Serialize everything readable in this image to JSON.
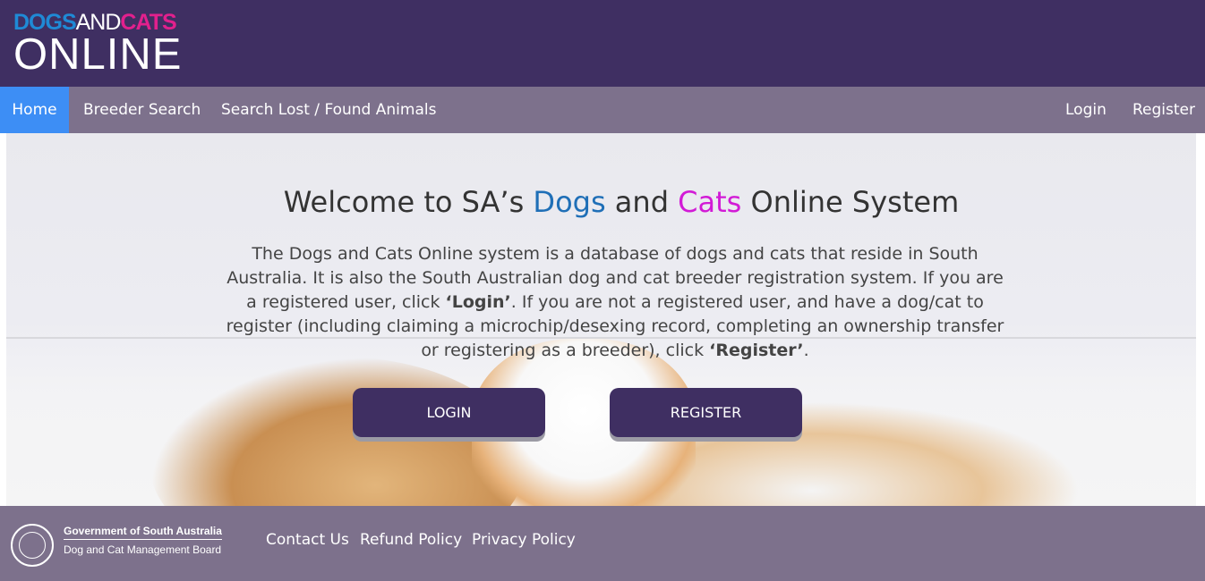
{
  "header": {
    "logo_word1": "DOGS",
    "logo_word2": "AND",
    "logo_word3": "CATS",
    "logo_bottom": "ONLINE",
    "logo_colors": {
      "dogs": "#1f8ad6",
      "and": "#ffffff",
      "cats": "#e2208d"
    }
  },
  "nav": {
    "home": "Home",
    "breeder_search": "Breeder Search",
    "lost_found": "Search Lost / Found Animals",
    "login": "Login",
    "register": "Register"
  },
  "hero": {
    "title_part1": "Welcome to SA’s ",
    "title_dogs": "Dogs",
    "title_and": " and ",
    "title_cats": "Cats",
    "title_part2": " Online System",
    "desc_1": "The Dogs and Cats Online system is a database of dogs and cats that reside in South Australia. It is also the South Australian dog and cat breeder registration system. If you are a registered user, click ",
    "desc_login": "‘Login’",
    "desc_2": ". If you are not a registered user, and have a dog/cat to register (including claiming a microchip/desexing record, completing an ownership transfer or registering as a breeder), click ",
    "desc_register": "‘Register’",
    "desc_3": ".",
    "login_button": "LOGIN",
    "register_button": "REGISTER"
  },
  "footer": {
    "gov_line1": "Government of South Australia",
    "gov_line2": "Dog and Cat Management Board",
    "contact": "Contact Us",
    "refund": "Refund Policy",
    "privacy": "Privacy Policy"
  },
  "colors": {
    "header_bg": "#3f2f62",
    "nav_bg": "#7d718c",
    "nav_active": "#3d8ef5",
    "button_bg": "#3f2f62"
  }
}
